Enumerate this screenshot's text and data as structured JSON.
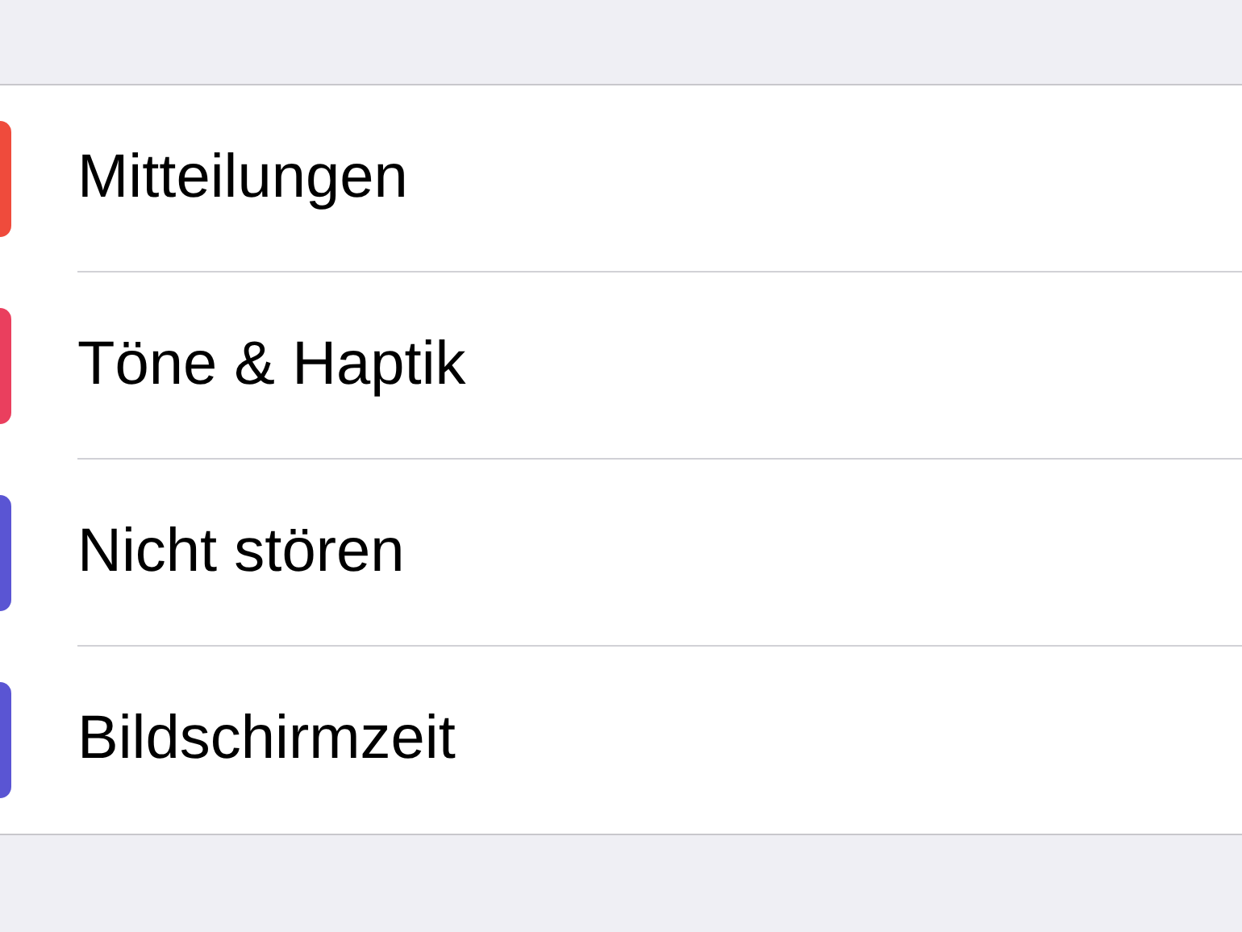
{
  "settings": [
    {
      "label": "Mitteilungen",
      "color": "#ef4b3c"
    },
    {
      "label": "Töne & Haptik",
      "color": "#ea3f5e"
    },
    {
      "label": "Nicht stören",
      "color": "#5a55d3"
    },
    {
      "label": "Bildschirmzeit",
      "color": "#5a55d3"
    }
  ]
}
